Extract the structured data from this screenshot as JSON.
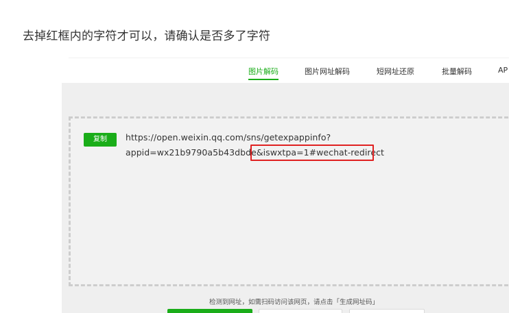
{
  "post": {
    "question": "去掉红框内的字符才可以，请确认是否多了字符"
  },
  "tabs": [
    {
      "label": "图片解码",
      "active": true
    },
    {
      "label": "图片网址解码",
      "active": false
    },
    {
      "label": "短网址还原",
      "active": false
    },
    {
      "label": "批量解码",
      "active": false
    },
    {
      "label": "AP",
      "active": false
    }
  ],
  "result": {
    "copy_label": "复制",
    "url_line1": "https://open.weixin.qq.com/sns/getexpappinfo?",
    "url_line2": "appid=wx21b9790a5b43dbde&iswxtpa=1#wechat-redirect"
  },
  "hint": {
    "text": "检测到网址，如需扫码访问该网页，请点击「生成网址码」"
  },
  "colors": {
    "accent": "#1aad19",
    "highlight": "#e02020",
    "panel_bg": "#efefef",
    "dashed_border": "#cdcdcd"
  }
}
